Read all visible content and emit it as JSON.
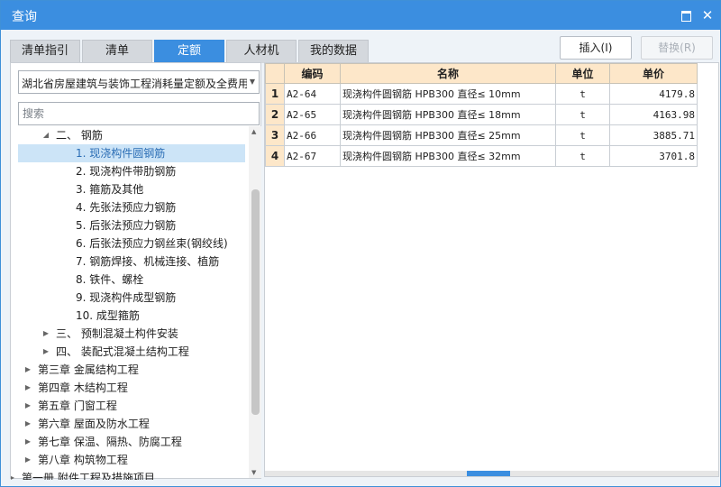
{
  "window": {
    "title": "查询"
  },
  "tabs": [
    {
      "label": "清单指引"
    },
    {
      "label": "清单"
    },
    {
      "label": "定额"
    },
    {
      "label": "人材机"
    },
    {
      "label": "我的数据"
    }
  ],
  "buttons": {
    "insert": "插入(I)",
    "replace": "替换(R)"
  },
  "library": {
    "selected": "湖北省房屋建筑与装饰工程消耗量定额及全费用"
  },
  "search": {
    "placeholder": "搜索",
    "value": ""
  },
  "tree": [
    {
      "label": "二、 钢筋",
      "twisty": "expanded",
      "indent": 1
    },
    {
      "label": "1. 现浇构件圆钢筋",
      "twisty": "none",
      "indent": 2,
      "selected": true
    },
    {
      "label": "2. 现浇构件带肋钢筋",
      "twisty": "none",
      "indent": 2
    },
    {
      "label": "3. 箍筋及其他",
      "twisty": "none",
      "indent": 2
    },
    {
      "label": "4. 先张法预应力钢筋",
      "twisty": "none",
      "indent": 2
    },
    {
      "label": "5. 后张法预应力钢筋",
      "twisty": "none",
      "indent": 2
    },
    {
      "label": "6. 后张法预应力钢丝束(钢绞线)",
      "twisty": "none",
      "indent": 2
    },
    {
      "label": "7. 钢筋焊接、机械连接、植筋",
      "twisty": "none",
      "indent": 2
    },
    {
      "label": "8. 铁件、螺栓",
      "twisty": "none",
      "indent": 2
    },
    {
      "label": "9. 现浇构件成型钢筋",
      "twisty": "none",
      "indent": 2
    },
    {
      "label": "10. 成型箍筋",
      "twisty": "none",
      "indent": 2
    },
    {
      "label": "三、 预制混凝土构件安装",
      "twisty": "collapsed",
      "indent": 1
    },
    {
      "label": "四、 装配式混凝土结构工程",
      "twisty": "collapsed",
      "indent": 1
    },
    {
      "label": "第三章 金属结构工程",
      "twisty": "collapsed",
      "indent": 0
    },
    {
      "label": "第四章 木结构工程",
      "twisty": "collapsed",
      "indent": 0
    },
    {
      "label": "第五章 门窗工程",
      "twisty": "collapsed",
      "indent": 0
    },
    {
      "label": "第六章 屋面及防水工程",
      "twisty": "collapsed",
      "indent": 0
    },
    {
      "label": "第七章 保温、隔热、防腐工程",
      "twisty": "collapsed",
      "indent": 0
    },
    {
      "label": "第八章 构筑物工程",
      "twisty": "collapsed",
      "indent": 0
    },
    {
      "label": "第一册 附件工程及措施项目",
      "twisty": "collapsed",
      "indent": -1
    }
  ],
  "table": {
    "columns": {
      "code": "编码",
      "name": "名称",
      "unit": "单位",
      "price": "单价"
    },
    "rows": [
      {
        "no": "1",
        "code": "A2-64",
        "name": "现浇构件圆钢筋 HPB300 直径≤ 10mm",
        "unit": "t",
        "price": "4179.8"
      },
      {
        "no": "2",
        "code": "A2-65",
        "name": "现浇构件圆钢筋 HPB300 直径≤ 18mm",
        "unit": "t",
        "price": "4163.98"
      },
      {
        "no": "3",
        "code": "A2-66",
        "name": "现浇构件圆钢筋 HPB300 直径≤ 25mm",
        "unit": "t",
        "price": "3885.71"
      },
      {
        "no": "4",
        "code": "A2-67",
        "name": "现浇构件圆钢筋 HPB300 直径≤ 32mm",
        "unit": "t",
        "price": "3701.8"
      }
    ]
  },
  "colors": {
    "accent": "#3b8ee0",
    "header": "#fde7c9",
    "selection": "#cce4f7"
  }
}
